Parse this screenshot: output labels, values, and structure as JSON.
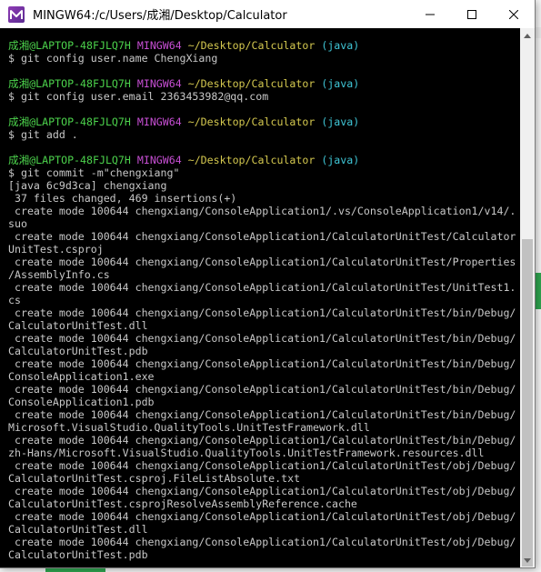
{
  "window": {
    "title": "MINGW64:/c/Users/成湘/Desktop/Calculator"
  },
  "terminal": {
    "colors": {
      "user": "#4cd24c",
      "system": "#c74fd4",
      "path": "#d4c84f",
      "branch": "#3fc6d6",
      "text": "#c8c8c8"
    },
    "prompt": {
      "user": "成湘@LAPTOP-48FJLQ7H",
      "system": "MINGW64",
      "path": "~/Desktop/Calculator",
      "branch": "(java)"
    },
    "commands": [
      "$ git config user.name ChengXiang",
      "$ git config user.email 2363453982@qq.com",
      "$ git add .",
      "$ git commit -m\"chengxiang\""
    ],
    "output": [
      "[java 6c9d3ca] chengxiang",
      " 37 files changed, 469 insertions(+)",
      " create mode 100644 chengxiang/ConsoleApplication1/.vs/ConsoleApplication1/v14/.",
      "suo",
      " create mode 100644 chengxiang/ConsoleApplication1/CalculatorUnitTest/Calculator",
      "UnitTest.csproj",
      " create mode 100644 chengxiang/ConsoleApplication1/CalculatorUnitTest/Properties",
      "/AssemblyInfo.cs",
      " create mode 100644 chengxiang/ConsoleApplication1/CalculatorUnitTest/UnitTest1.",
      "cs",
      " create mode 100644 chengxiang/ConsoleApplication1/CalculatorUnitTest/bin/Debug/",
      "CalculatorUnitTest.dll",
      " create mode 100644 chengxiang/ConsoleApplication1/CalculatorUnitTest/bin/Debug/",
      "CalculatorUnitTest.pdb",
      " create mode 100644 chengxiang/ConsoleApplication1/CalculatorUnitTest/bin/Debug/",
      "ConsoleApplication1.exe",
      " create mode 100644 chengxiang/ConsoleApplication1/CalculatorUnitTest/bin/Debug/",
      "ConsoleApplication1.pdb",
      " create mode 100644 chengxiang/ConsoleApplication1/CalculatorUnitTest/bin/Debug/",
      "Microsoft.VisualStudio.QualityTools.UnitTestFramework.dll",
      " create mode 100644 chengxiang/ConsoleApplication1/CalculatorUnitTest/bin/Debug/",
      "zh-Hans/Microsoft.VisualStudio.QualityTools.UnitTestFramework.resources.dll",
      " create mode 100644 chengxiang/ConsoleApplication1/CalculatorUnitTest/obj/Debug/",
      "CalculatorUnitTest.csproj.FileListAbsolute.txt",
      " create mode 100644 chengxiang/ConsoleApplication1/CalculatorUnitTest/obj/Debug/",
      "CalculatorUnitTest.csprojResolveAssemblyReference.cache",
      " create mode 100644 chengxiang/ConsoleApplication1/CalculatorUnitTest/obj/Debug/",
      "CalculatorUnitTest.dll",
      " create mode 100644 chengxiang/ConsoleApplication1/CalculatorUnitTest/obj/Debug/",
      "CalculatorUnitTest.pdb"
    ]
  }
}
